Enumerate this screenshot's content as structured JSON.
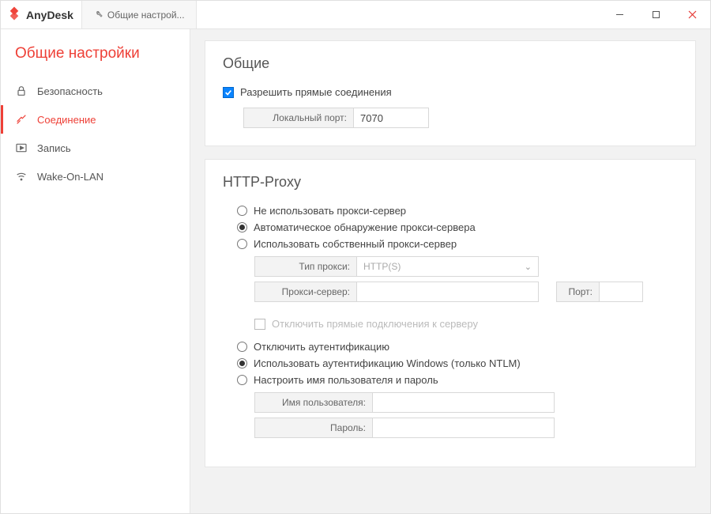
{
  "titlebar": {
    "brand": "AnyDesk",
    "tab_label": "Общие настрой..."
  },
  "sidebar": {
    "title": "Общие настройки",
    "items": [
      {
        "label": "Безопасность"
      },
      {
        "label": "Соединение"
      },
      {
        "label": "Запись"
      },
      {
        "label": "Wake-On-LAN"
      }
    ]
  },
  "general": {
    "heading": "Общие",
    "allow_direct_label": "Разрешить прямые соединения",
    "local_port_label": "Локальный порт:",
    "local_port_value": "7070"
  },
  "proxy": {
    "heading": "HTTP-Proxy",
    "radio_noproxy": "Не использовать прокси-сервер",
    "radio_auto": "Автоматическое обнаружение прокси-сервера",
    "radio_manual": "Использовать собственный прокси-сервер",
    "type_label": "Тип прокси:",
    "type_value": "HTTP(S)",
    "server_label": "Прокси-сервер:",
    "server_value": "",
    "port_label": "Порт:",
    "port_value": "",
    "disable_direct_label": "Отключить прямые подключения к серверу",
    "radio_noauth": "Отключить аутентификацию",
    "radio_winath": "Использовать аутентификацию Windows (только NTLM)",
    "radio_custath": "Настроить имя пользователя и пароль",
    "user_label": "Имя пользователя:",
    "user_value": "",
    "pass_label": "Пароль:",
    "pass_value": ""
  }
}
